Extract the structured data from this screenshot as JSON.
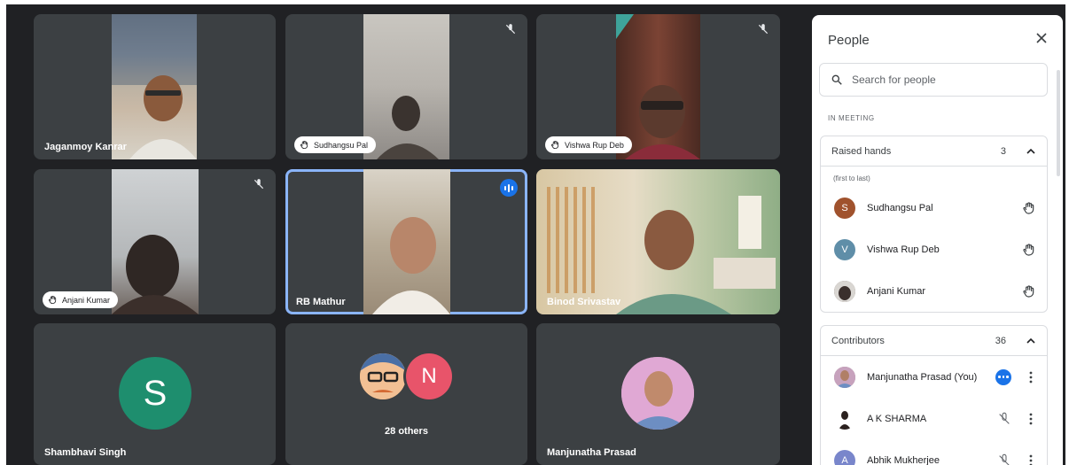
{
  "grid": {
    "tiles": [
      {
        "name": "Jaganmoy Kanrar",
        "style": "plain",
        "muted": false
      },
      {
        "name": "Sudhangsu Pal",
        "style": "chip",
        "muted": true
      },
      {
        "name": "Vishwa Rup Deb",
        "style": "chip",
        "muted": true
      },
      {
        "name": "Anjani Kumar",
        "style": "chip",
        "muted": true
      },
      {
        "name": "RB Mathur",
        "style": "plain",
        "speaking": true
      },
      {
        "name": "Binod Srivastav",
        "style": "plain"
      },
      {
        "name": "Shambhavi Singh",
        "style": "plain",
        "initial": "S",
        "avatar_color": "#1e8e6e"
      },
      {
        "name": "28 others",
        "style": "others",
        "initial": "N",
        "avatar_color": "#e8546a"
      },
      {
        "name": "Manjunatha Prasad",
        "style": "plain"
      }
    ]
  },
  "panel": {
    "title": "People",
    "search_placeholder": "Search for people",
    "section_label": "IN MEETING",
    "raised_hands": {
      "label": "Raised hands",
      "count": "3",
      "note": "(first to last)",
      "people": [
        {
          "name": "Sudhangsu Pal",
          "initial": "S",
          "color": "#a0522d",
          "icon": "raised-hand-icon"
        },
        {
          "name": "Vishwa Rup Deb",
          "initial": "V",
          "color": "#5f8ea8",
          "icon": "raised-hand-icon"
        },
        {
          "name": "Anjani Kumar",
          "initial": "",
          "color": "#6b5a52",
          "icon": "raised-hand-icon"
        }
      ]
    },
    "contributors": {
      "label": "Contributors",
      "count": "36",
      "people": [
        {
          "name": "Manjunatha Prasad (You)",
          "initial": "",
          "color": "#8f7f8c",
          "icon": "more-options-badge-icon"
        },
        {
          "name": "A K SHARMA",
          "initial": "",
          "color": "#ffffff",
          "icon": "mic-off-icon"
        },
        {
          "name": "Abhik Mukherjee",
          "initial": "A",
          "color": "#7986cb",
          "icon": "mic-off-icon"
        }
      ]
    }
  }
}
